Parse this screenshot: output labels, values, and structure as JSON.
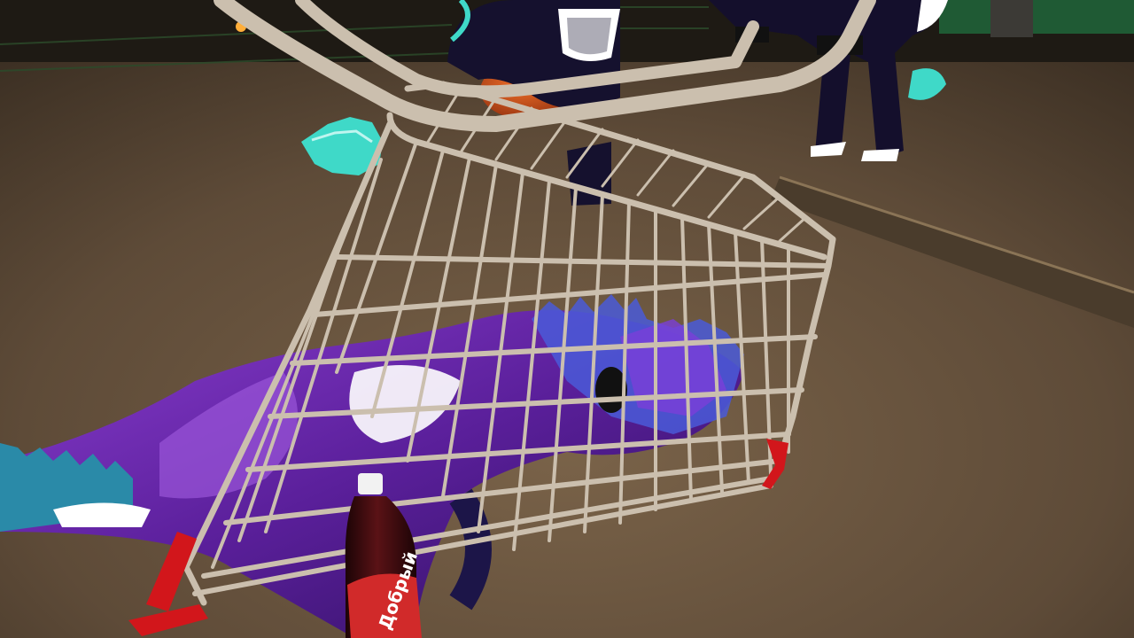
{
  "scene": {
    "description_visible_text": "",
    "bottle_label": "Добрый",
    "colors": {
      "ground": "#6e5a44",
      "ground_dark": "#3a2e22",
      "cart_wire": "#cbbfae",
      "cart_red": "#d2161b",
      "creature_purple": "#6a2aa8",
      "creature_dark": "#1c1548",
      "crystal_teal": "#3fd9c8",
      "bottle_liquid": "#3a0a0e",
      "bottle_label_red": "#d12a2a",
      "pumpkin_orange": "#e0501c",
      "fence_green": "#2c4a2a"
    },
    "icons": [
      "shopping-cart",
      "plastic-bottle",
      "creature-avatar"
    ]
  }
}
